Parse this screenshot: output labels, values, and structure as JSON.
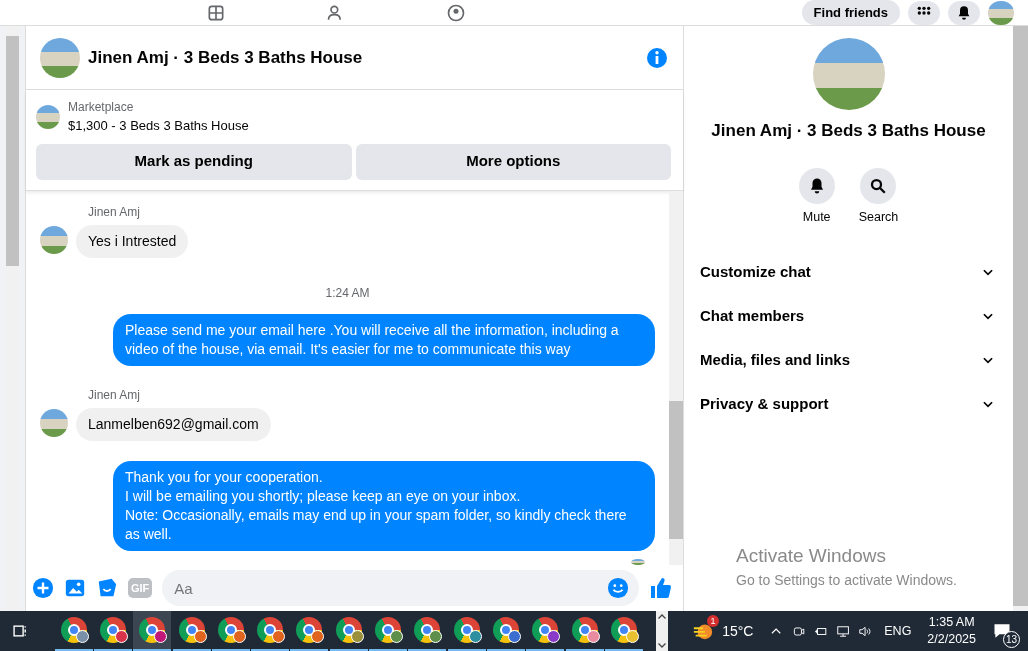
{
  "top_bar": {
    "find_friends": "Find friends"
  },
  "chat": {
    "title": "Jinen Amj · 3 Beds 3 Baths House",
    "listing": {
      "source": "Marketplace",
      "summary": "$1,300 - 3 Beds 3 Baths House",
      "actions": [
        "Mark as pending",
        "More options"
      ]
    },
    "messages": [
      {
        "kind": "incoming",
        "sender": "Jinen Amj",
        "text": "Yes i Intrested"
      },
      {
        "kind": "timestamp",
        "text": "1:24 AM"
      },
      {
        "kind": "outgoing",
        "text": "Please send me your email here .You will receive all the information, including a video of the house, via email. It's easier for me to communicate this way"
      },
      {
        "kind": "incoming",
        "sender": "Jinen Amj",
        "text": "Lanmelben692@gmail.com"
      },
      {
        "kind": "outgoing",
        "text": "Thank you for your cooperation.\nI will be emailing you shortly; please keep an eye on your inbox.\nNote: Occasionally, emails may end up in your spam folder, so kindly check there as well."
      }
    ],
    "composer": {
      "placeholder": "Aa",
      "gif": "GIF"
    }
  },
  "details": {
    "title": "Jinen Amj · 3 Beds 3 Baths House",
    "actions": [
      {
        "kind": "mute",
        "label": "Mute"
      },
      {
        "kind": "search",
        "label": "Search"
      }
    ],
    "sections": [
      {
        "label": "Customize chat",
        "expanded": false
      },
      {
        "label": "Chat members",
        "expanded": false
      },
      {
        "label": "Media, files and links",
        "expanded": false
      },
      {
        "label": "Privacy & support",
        "expanded": false
      }
    ]
  },
  "activation_notice": {
    "title": "Activate Windows",
    "subtitle": "Go to Settings to activate Windows."
  },
  "taskbar": {
    "apps": [
      {
        "selected": false,
        "color": "#7a8fa8"
      },
      {
        "selected": false,
        "color": "#d8334a"
      },
      {
        "selected": true,
        "color": "#c2187a"
      },
      {
        "selected": false,
        "color": "#e0641e"
      },
      {
        "selected": false,
        "color": "#e0641e"
      },
      {
        "selected": false,
        "color": "#e0641e"
      },
      {
        "selected": false,
        "color": "#e0641e"
      },
      {
        "selected": false,
        "color": "#9a8f3a"
      },
      {
        "selected": false,
        "color": "#5e8f4a"
      },
      {
        "selected": false,
        "color": "#5e8f4a"
      },
      {
        "selected": false,
        "color": "#2e8fa0"
      },
      {
        "selected": false,
        "color": "#3a6fd0"
      },
      {
        "selected": false,
        "color": "#8a3ac8"
      },
      {
        "selected": false,
        "color": "#e88aa0"
      },
      {
        "selected": false,
        "color": "#e8c030"
      }
    ],
    "weather_badge": "1",
    "temperature": "15°C",
    "language": "ENG",
    "time": "1:35 AM",
    "date": "2/2/2025",
    "notifications": "13"
  }
}
